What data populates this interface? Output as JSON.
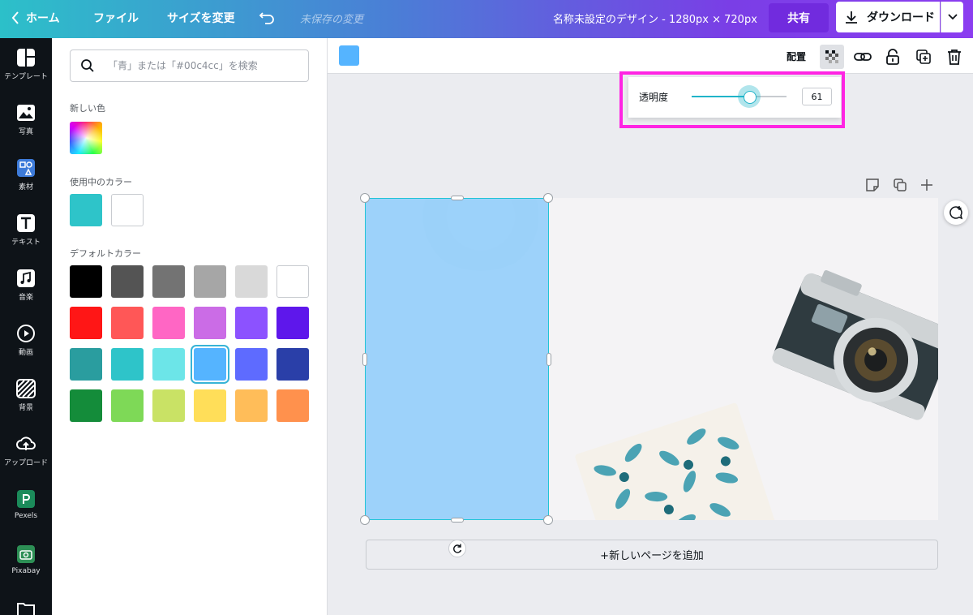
{
  "topbar": {
    "home": "ホーム",
    "file": "ファイル",
    "resize": "サイズを変更",
    "unsaved": "未保存の変更",
    "design_title": "名称未設定のデザイン - 1280px × 720px",
    "share": "共有",
    "download": "ダウンロード"
  },
  "sidebar": {
    "items": [
      {
        "label": "テンプレート",
        "icon": "template-icon"
      },
      {
        "label": "写真",
        "icon": "photo-icon"
      },
      {
        "label": "素材",
        "icon": "elements-icon"
      },
      {
        "label": "テキスト",
        "icon": "text-icon"
      },
      {
        "label": "音楽",
        "icon": "music-icon"
      },
      {
        "label": "動画",
        "icon": "video-icon"
      },
      {
        "label": "背景",
        "icon": "background-icon"
      },
      {
        "label": "アップロード",
        "icon": "upload-icon"
      },
      {
        "label": "Pexels",
        "icon": "pexels-icon"
      },
      {
        "label": "Pixabay",
        "icon": "pixabay-icon"
      }
    ]
  },
  "panel": {
    "search_placeholder": "「青」または「#00c4cc」を検索",
    "new_color": "新しい色",
    "in_use": "使用中のカラー",
    "default_colors": "デフォルトカラー",
    "in_use_colors": [
      "#2ec4c9",
      "#ffffff"
    ],
    "palette": [
      [
        "#000000",
        "#545454",
        "#737373",
        "#a6a6a6",
        "#d9d9d9",
        "#ffffff"
      ],
      [
        "#ff1616",
        "#ff5757",
        "#ff66c4",
        "#cb6ce6",
        "#8c52ff",
        "#5e17eb"
      ],
      [
        "#2a9d9f",
        "#2ec4c9",
        "#6ce5e8",
        "#55b4ff",
        "#5e6bff",
        "#2a3fa8"
      ],
      [
        "#148c3a",
        "#7ed957",
        "#c9e265",
        "#ffde59",
        "#ffbd59",
        "#ff914d"
      ]
    ],
    "selected_color": "#55b4ff"
  },
  "toolbar": {
    "arrange": "配置"
  },
  "transparency": {
    "label": "透明度",
    "value": "61",
    "fraction": 0.61
  },
  "canvas": {
    "add_page": "+新しいページを追加"
  }
}
